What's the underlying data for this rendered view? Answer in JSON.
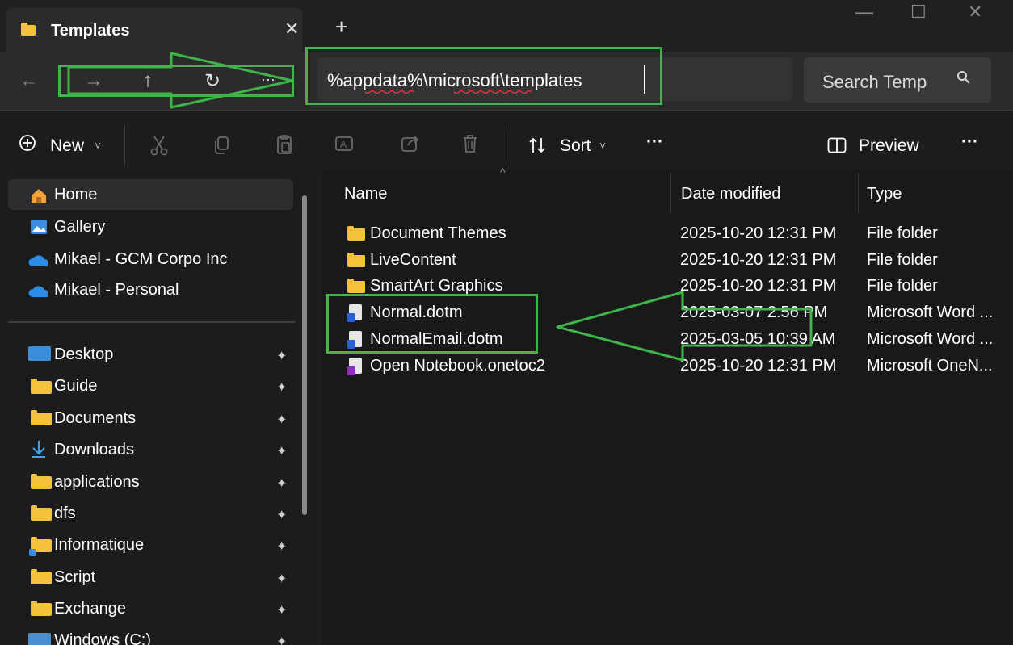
{
  "window": {
    "tab_title": "Templates",
    "tab_close": "✕",
    "new_tab": "+",
    "minimize": "—",
    "maximize": "☐",
    "close": "✕"
  },
  "nav": {
    "back": "←",
    "forward": "→",
    "up": "↑",
    "refresh": "↻",
    "more": "···",
    "address_value": "%appdata%\\microsoft\\templates",
    "search_placeholder": "Search Temp",
    "search_icon": "search-icon"
  },
  "toolbar": {
    "new_label": "New",
    "new_chevron": "˅",
    "sort_label": "Sort",
    "sort_chevron": "˅",
    "more": "···",
    "preview_label": "Preview",
    "more_right": "···"
  },
  "sidebar": {
    "top_items": [
      {
        "label": "Home",
        "icon": "home-icon"
      },
      {
        "label": "Gallery",
        "icon": "gallery-icon"
      },
      {
        "label": "Mikael - GCM Corpo Inc",
        "icon": "onedrive-icon"
      },
      {
        "label": "Mikael - Personal",
        "icon": "onedrive-icon"
      }
    ],
    "pinned_items": [
      {
        "label": "Desktop",
        "icon": "desktop-icon"
      },
      {
        "label": "Guide",
        "icon": "folder-icon"
      },
      {
        "label": "Documents",
        "icon": "folder-icon"
      },
      {
        "label": "Downloads",
        "icon": "download-icon"
      },
      {
        "label": "applications",
        "icon": "folder-icon"
      },
      {
        "label": "dfs",
        "icon": "folder-icon"
      },
      {
        "label": "Informatique",
        "icon": "folder-icon"
      },
      {
        "label": "Script",
        "icon": "folder-icon"
      },
      {
        "label": "Exchange",
        "icon": "folder-icon"
      },
      {
        "label": "Windows (C:)",
        "icon": "drive-icon"
      }
    ],
    "pin_glyph": "📌"
  },
  "files": {
    "columns": [
      "Name",
      "Date modified",
      "Type"
    ],
    "sort_indicator": "^",
    "rows": [
      {
        "name": "Document Themes",
        "date": "2025-10-20 12:31 PM",
        "type": "File folder",
        "icon": "folder-icon"
      },
      {
        "name": "LiveContent",
        "date": "2025-10-20 12:31 PM",
        "type": "File folder",
        "icon": "folder-icon"
      },
      {
        "name": "SmartArt Graphics",
        "date": "2025-10-20 12:31 PM",
        "type": "File folder",
        "icon": "folder-icon"
      },
      {
        "name": "Normal.dotm",
        "date": "2025-03-07 2:56 PM",
        "type": "Microsoft Word ...",
        "icon": "word-template-icon"
      },
      {
        "name": "NormalEmail.dotm",
        "date": "2025-03-05 10:39 AM",
        "type": "Microsoft Word ...",
        "icon": "word-template-icon"
      },
      {
        "name": "Open Notebook.onetoc2",
        "date": "2025-10-20 12:31 PM",
        "type": "Microsoft OneN...",
        "icon": "onenote-icon"
      }
    ]
  },
  "colors": {
    "window_bg": "#1c1c1c",
    "annotation_green": "#3fb44a",
    "folder_yellow": "#f3c13a"
  }
}
